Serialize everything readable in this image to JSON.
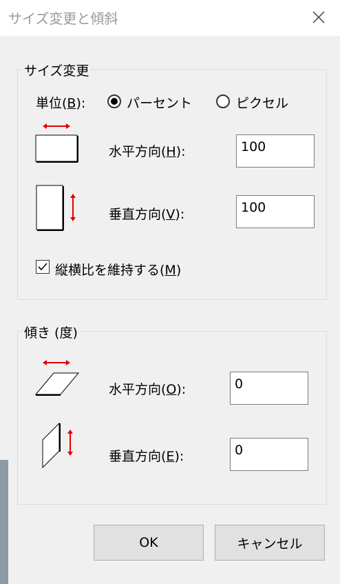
{
  "window": {
    "title": "サイズ変更と傾斜"
  },
  "resize": {
    "group_title": "サイズ変更",
    "unit_label": "単位(",
    "unit_key": "B",
    "unit_suffix": "):",
    "option_percent": "パーセント",
    "option_pixel": "ピクセル",
    "selected": "パーセント",
    "horizontal_label": "水平方向(",
    "horizontal_key": "H",
    "horizontal_suffix": "):",
    "horizontal_value": "100",
    "vertical_label": "垂直方向(",
    "vertical_key": "V",
    "vertical_suffix": "):",
    "vertical_value": "100",
    "aspect_label": "縦横比を維持する(",
    "aspect_key": "M",
    "aspect_suffix": ")",
    "aspect_checked": true
  },
  "skew": {
    "group_title": "傾き (度)",
    "horizontal_label": "水平方向(",
    "horizontal_key": "O",
    "horizontal_suffix": "):",
    "horizontal_value": "0",
    "vertical_label": "垂直方向(",
    "vertical_key": "E",
    "vertical_suffix": "):",
    "vertical_value": "0"
  },
  "buttons": {
    "ok": "OK",
    "cancel": "キャンセル"
  },
  "colors": {
    "arrow": "#e00000",
    "title_text": "#9a9a9a"
  }
}
